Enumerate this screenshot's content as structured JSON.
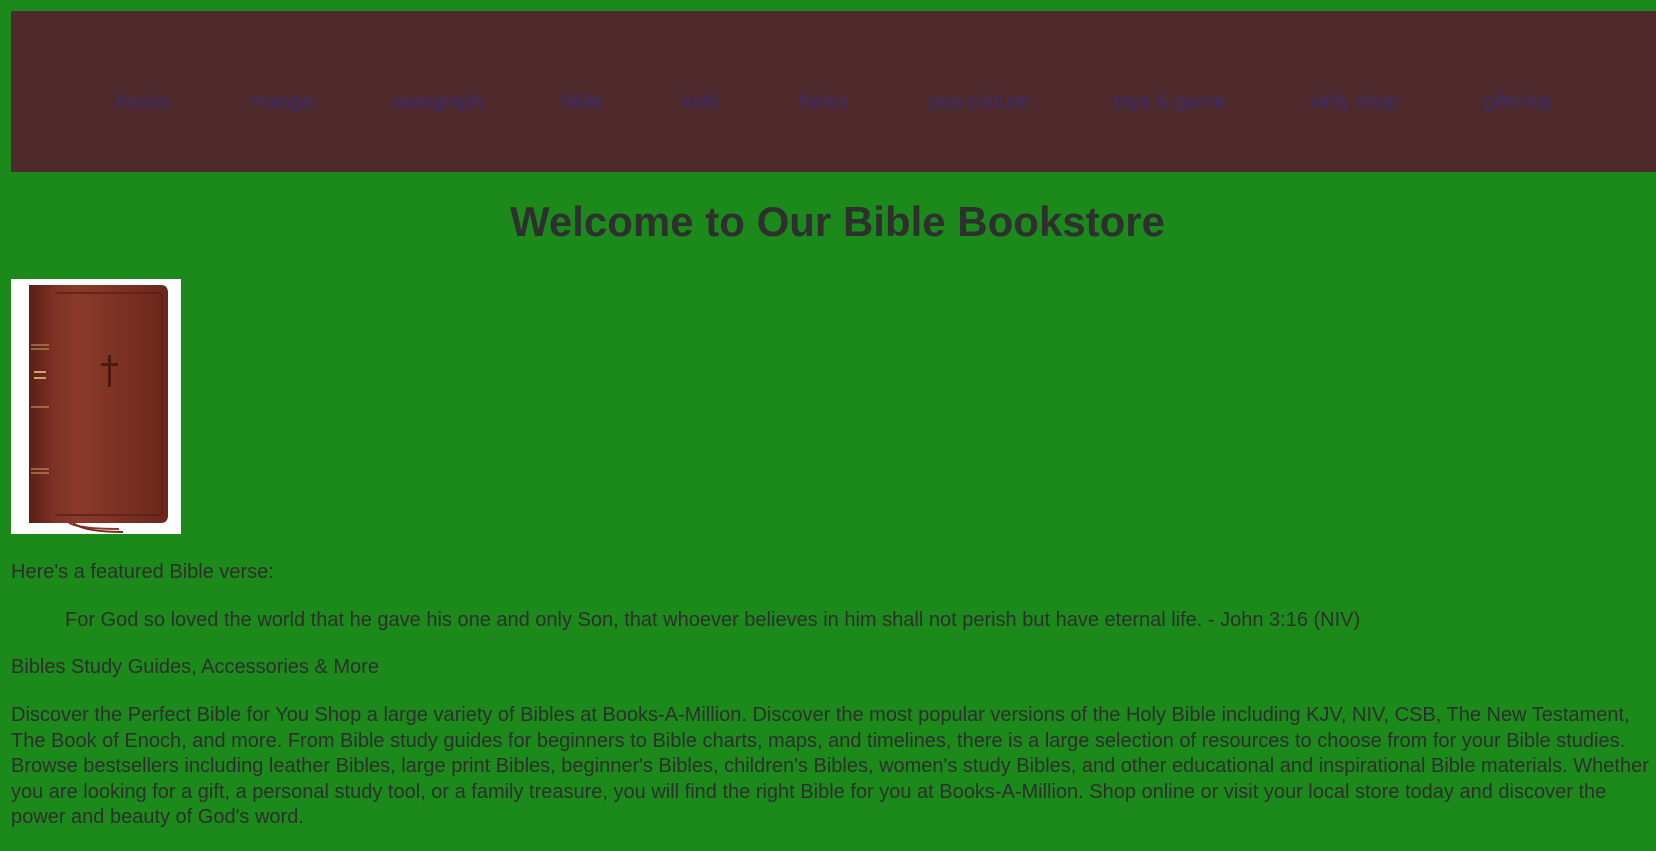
{
  "nav": {
    "items": [
      {
        "label": "books"
      },
      {
        "label": "manga"
      },
      {
        "label": "autograph"
      },
      {
        "label": "bible"
      },
      {
        "label": "kids"
      },
      {
        "label": "funko"
      },
      {
        "label": "pop culture"
      },
      {
        "label": "toys & game"
      },
      {
        "label": "vinly shop"
      },
      {
        "label": "giftshop"
      }
    ]
  },
  "main": {
    "title": "Welcome to Our Bible Bookstore",
    "featured_intro": "Here's a featured Bible verse:",
    "verse": "For God so loved the world that he gave his one and only Son, that whoever believes in him shall not perish but have eternal life. - John 3:16 (NIV)",
    "section_heading": "Bibles Study Guides, Accessories & More",
    "description": "Discover the Perfect Bible for You Shop a large variety of Bibles at Books-A-Million. Discover the most popular versions of the Holy Bible including KJV, NIV, CSB, The New Testament, The Book of Enoch, and more. From Bible study guides for beginners to Bible charts, maps, and timelines, there is a large selection of resources to choose from for your Bible studies. Browse bestsellers including leather Bibles, large print Bibles, beginner's Bibles, children's Bibles, women's study Bibles, and other educational and inspirational Bible materials. Whether you are looking for a gift, a personal study tool, or a family treasure, you will find the right Bible for you at Books-A-Million. Shop online or visit your local store today and discover the power and beauty of God's word."
  },
  "colors": {
    "page_background": "#1b8a1b",
    "nav_background": "#4f2a2c",
    "nav_link": "#3b2a6b",
    "text": "#2e2e2e"
  }
}
